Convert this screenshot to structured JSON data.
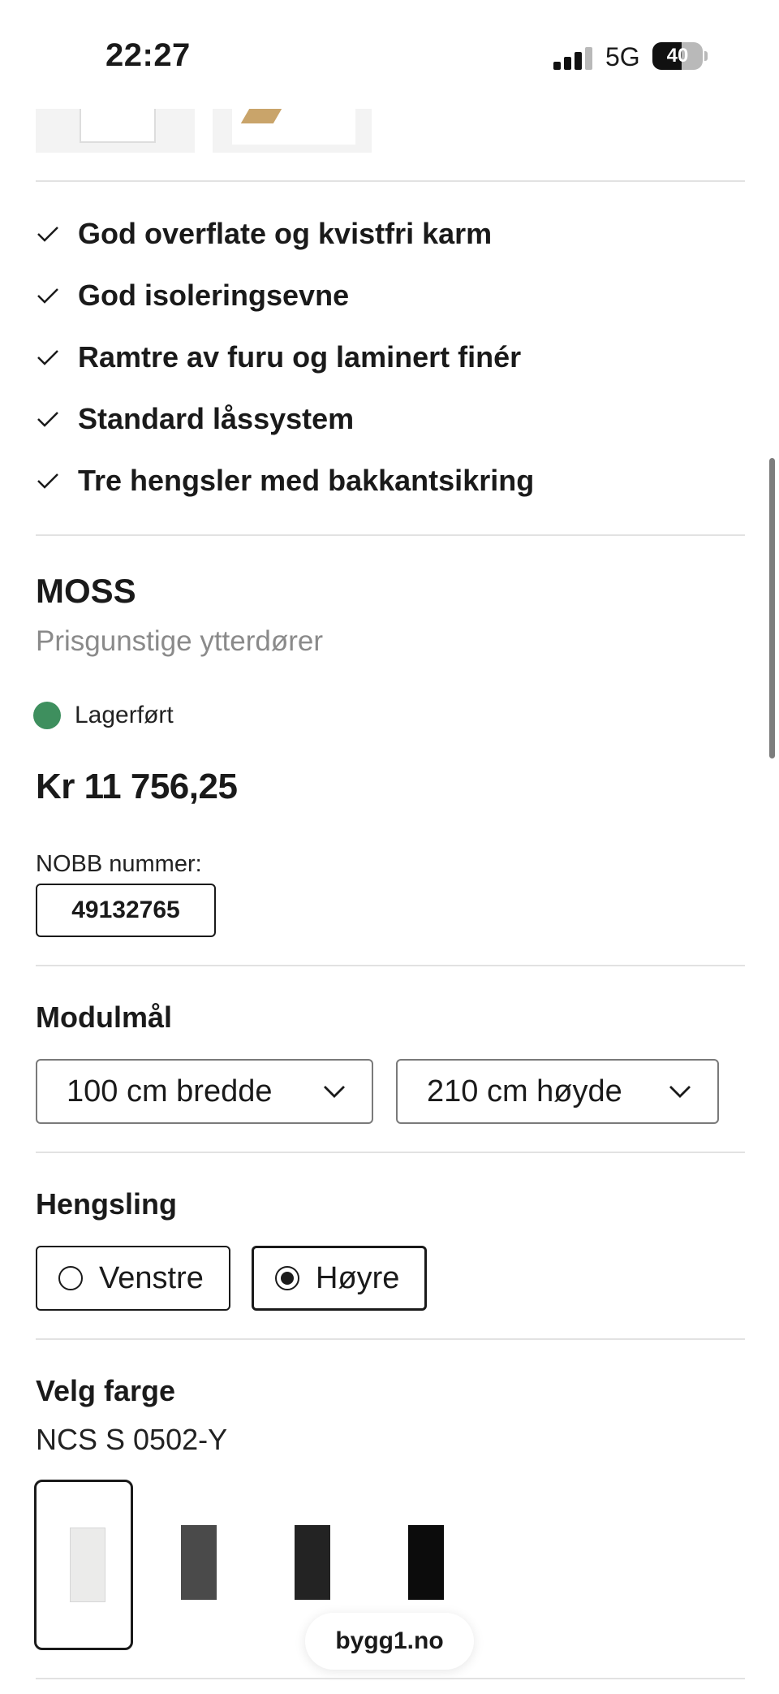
{
  "status_bar": {
    "time": "22:27",
    "network": "5G",
    "battery": "40"
  },
  "features": [
    "God overflate og kvistfri karm",
    "God isoleringsevne",
    "Ramtre av furu og laminert finér",
    "Standard låssystem",
    "Tre hengsler med bakkantsikring"
  ],
  "product": {
    "name": "MOSS",
    "subtitle": "Prisgunstige ytterdører",
    "stock_status": "Lagerført",
    "stock_color": "#3e8f5e",
    "price": "Kr 11 756,25",
    "nobb_label": "NOBB nummer:",
    "nobb_number": "49132765"
  },
  "module": {
    "heading": "Modulmål",
    "width_value": "100 cm bredde",
    "height_value": "210 cm høyde"
  },
  "hinge": {
    "heading": "Hengsling",
    "options": [
      {
        "label": "Venstre",
        "selected": false
      },
      {
        "label": "Høyre",
        "selected": true
      }
    ]
  },
  "color": {
    "heading": "Velg farge",
    "selected_name": "NCS S 0502-Y",
    "swatches": [
      {
        "color": "#ebebea",
        "selected": true
      },
      {
        "color": "#4a4a4a",
        "selected": false
      },
      {
        "color": "#232323",
        "selected": false
      },
      {
        "color": "#0c0c0c",
        "selected": false
      }
    ]
  },
  "site_badge": "bygg1.no"
}
